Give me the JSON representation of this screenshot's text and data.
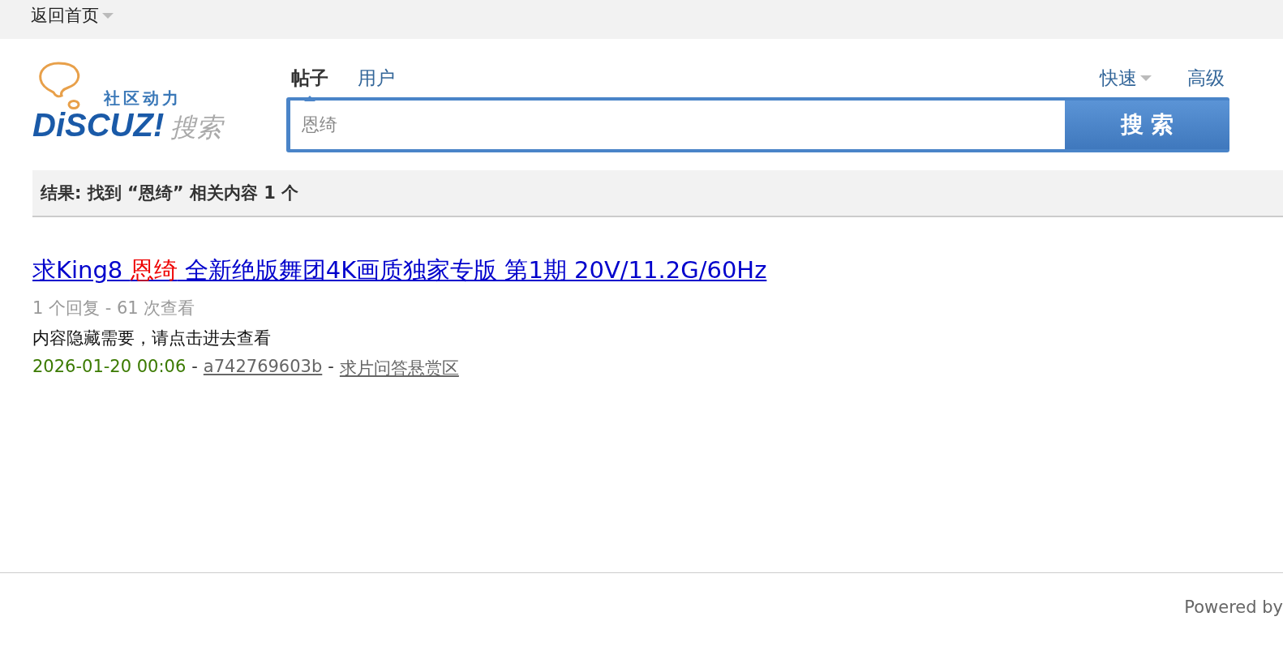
{
  "top_bar": {
    "home_link": "返回首页"
  },
  "logo": {
    "tagline": "社区动力",
    "brand": "DiSCUZ!",
    "suffix": "搜索"
  },
  "search_tabs": [
    {
      "label": "帖子",
      "selected": true
    },
    {
      "label": "用户",
      "selected": false
    }
  ],
  "search_options": [
    {
      "label": "快速",
      "kind": "dropdown"
    },
    {
      "label": "高级",
      "kind": "link"
    }
  ],
  "search": {
    "value": "恩绮",
    "button": "搜 索"
  },
  "results_header": "结果: 找到 “恩绮” 相关内容 1 个",
  "results": [
    {
      "title_parts": [
        {
          "text": "求King8 ",
          "highlight": false
        },
        {
          "text": "恩绮",
          "highlight": true
        },
        {
          "text": " 全新绝版舞团4K画质独家专版 第1期 20V/11.2G/60Hz",
          "highlight": false
        }
      ],
      "stats": "1 个回复 - 61 次查看",
      "summary": "内容隐藏需要，请点击进去查看",
      "date": "2026-01-20 00:06",
      "separator_1": "-",
      "author": "a742769603b",
      "separator_2": "-",
      "forum": "求片问答悬赏区"
    }
  ],
  "footer": {
    "powered": "Powered by"
  }
}
